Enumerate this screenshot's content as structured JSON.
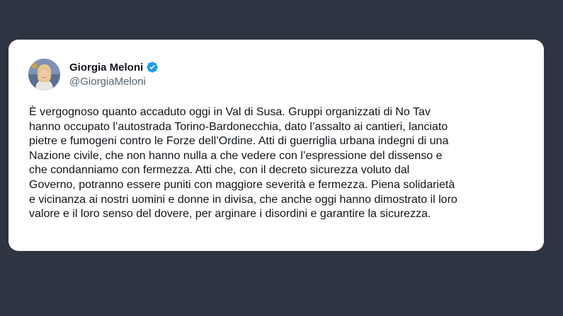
{
  "tweet": {
    "author": {
      "display_name": "Giorgia Meloni",
      "handle": "@GiorgiaMeloni",
      "verified_icon": "verified-badge-icon",
      "verified_color": "#1d9bf0"
    },
    "text": "È vergognoso quanto accaduto oggi in Val di Susa. Gruppi organizzati di No Tav\nhanno occupato l’autostrada Torino-Bardonecchia, dato l’assalto ai cantieri, lanciato\npietre e fumogeni contro le Forze dell’Ordine. Atti di guerriglia urbana indegni di una\nNazione civile, che non hanno nulla a che vedere con l’espressione del dissenso e\nche condanniamo con fermezza. Atti che, con il decreto sicurezza voluto dal\nGoverno, potranno essere puniti con maggiore severità e fermezza. Piena solidarietà\ne vicinanza ai nostri uomini e donne in divisa, che anche oggi hanno dimostrato il loro\nvalore e il loro senso del dovere, per arginare i disordini e garantire la sicurezza."
  },
  "colors": {
    "background": "#2e3441",
    "card": "#ffffff",
    "text": "#0f1419",
    "secondary_text": "#536471"
  }
}
